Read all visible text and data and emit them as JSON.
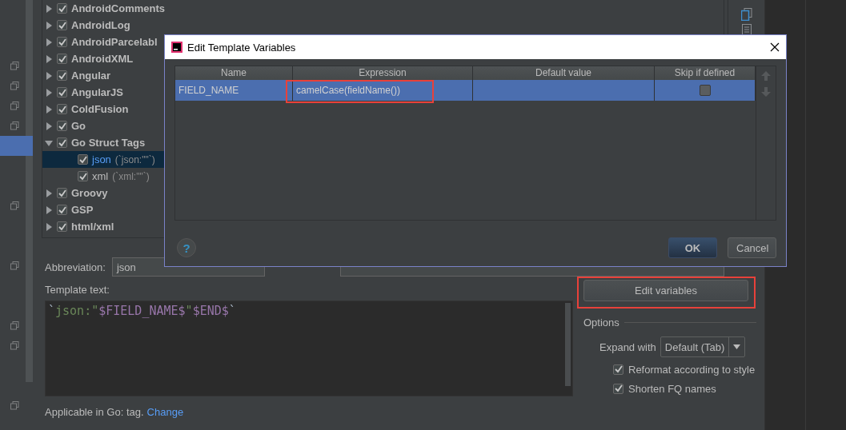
{
  "tree": {
    "items": [
      {
        "label": "AndroidComments",
        "checked": true,
        "expanded": false,
        "selected": false
      },
      {
        "label": "AndroidLog",
        "checked": true,
        "expanded": false,
        "selected": false
      },
      {
        "label": "AndroidParcelabl",
        "checked": true,
        "expanded": false,
        "selected": false
      },
      {
        "label": "AndroidXML",
        "checked": true,
        "expanded": false,
        "selected": false
      },
      {
        "label": "Angular",
        "checked": true,
        "expanded": false,
        "selected": false
      },
      {
        "label": "AngularJS",
        "checked": true,
        "expanded": false,
        "selected": false
      },
      {
        "label": "ColdFusion",
        "checked": true,
        "expanded": false,
        "selected": false
      },
      {
        "label": "Go",
        "checked": true,
        "expanded": false,
        "selected": false
      },
      {
        "label": "Go Struct Tags",
        "checked": true,
        "expanded": true,
        "selected": false,
        "children": [
          {
            "label": "json",
            "detail": "(`json:\"\"`)",
            "checked": true,
            "selected": true
          },
          {
            "label": "xml",
            "detail": "(`xml:\"\"`)",
            "checked": true,
            "selected": false
          }
        ]
      },
      {
        "label": "Groovy",
        "checked": true,
        "expanded": false,
        "selected": false
      },
      {
        "label": "GSP",
        "checked": true,
        "expanded": false,
        "selected": false
      },
      {
        "label": "html/xml",
        "checked": true,
        "expanded": false,
        "selected": false
      }
    ]
  },
  "form": {
    "abbreviation_label": "Abbreviation:",
    "abbreviation": "json",
    "template_label": "Template text:",
    "template_text": [
      {
        "text": "`",
        "kind": "plain"
      },
      {
        "text": "json:\"",
        "kind": "string"
      },
      {
        "text": "$FIELD_NAME$",
        "kind": "variable"
      },
      {
        "text": "\"",
        "kind": "string"
      },
      {
        "text": "$END$",
        "kind": "variable"
      },
      {
        "text": "`",
        "kind": "plain"
      }
    ],
    "applicable": "Applicable in Go: tag.",
    "change_link": "Change",
    "edit_variables": {
      "label": "Edit variables",
      "highlighted": true
    },
    "options_title": "Options",
    "expand_label": "Expand with",
    "expand_value": "Default (Tab)",
    "options": [
      {
        "label": "Reformat according to style",
        "checked": true
      },
      {
        "label": "Shorten FQ names",
        "checked": true
      }
    ]
  },
  "dialog": {
    "title": "Edit Template Variables",
    "columns": [
      "Name",
      "Expression",
      "Default value",
      "Skip if defined"
    ],
    "rows": [
      {
        "name": "FIELD_NAME",
        "expression": "camelCase(fieldName())",
        "expression_highlighted": true,
        "skip_if_defined": false,
        "selected": true
      }
    ],
    "help": "?",
    "buttons": [
      {
        "label": "OK",
        "default": true
      },
      {
        "label": "Cancel",
        "default": false
      }
    ]
  }
}
